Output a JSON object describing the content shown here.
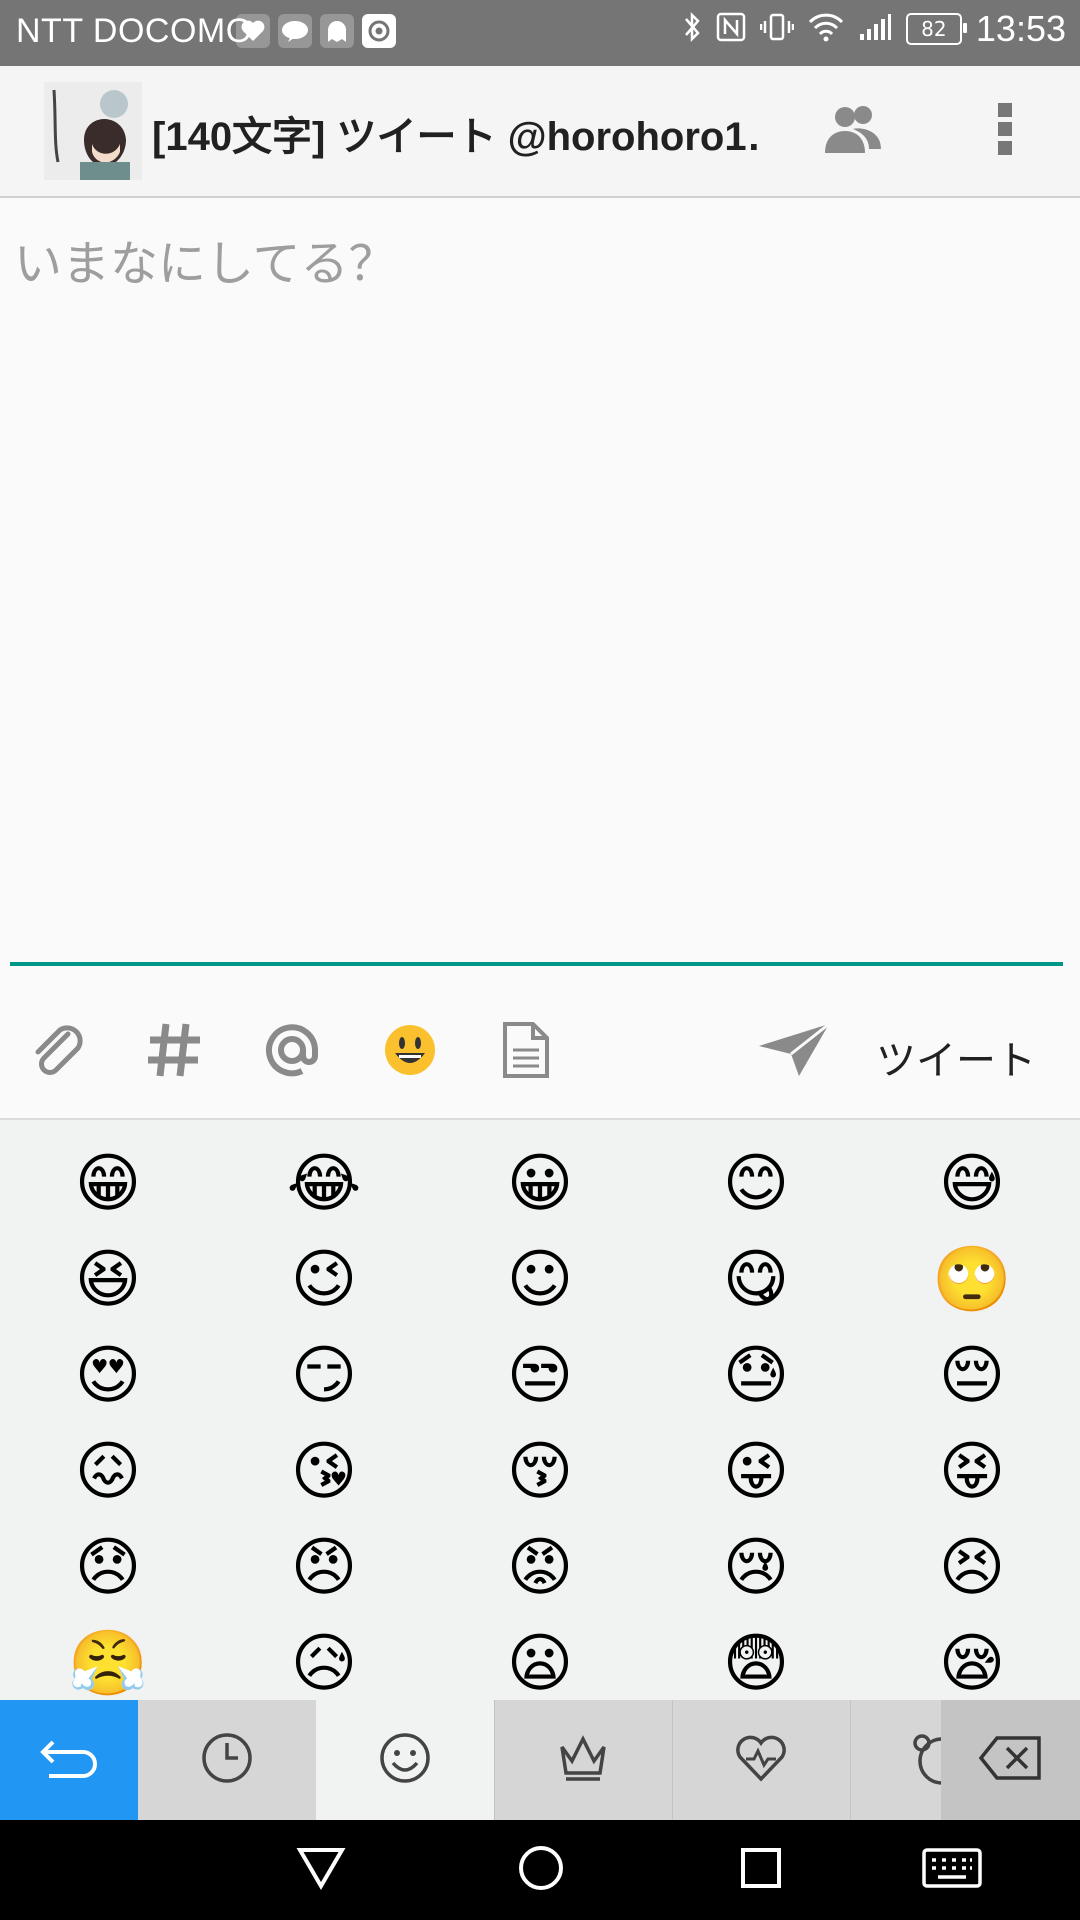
{
  "status_bar": {
    "carrier": "NTT DOCOMO",
    "battery": "82",
    "time": "13:53",
    "notification_icons": [
      "heart-pulse-icon",
      "line-icon",
      "ghost-icon",
      "at-icon"
    ]
  },
  "toolbar": {
    "title": "[140文字] ツイート @horohoro1…",
    "actions": [
      "accounts-icon",
      "overflow-menu-icon"
    ]
  },
  "editor": {
    "placeholder": "いまなにしてる？",
    "value": ""
  },
  "action_bar": {
    "icons": [
      "attach-icon",
      "hashtag-icon",
      "mention-icon",
      "emoji-icon",
      "template-icon",
      "send-icon"
    ],
    "tweet_label": "ツイート"
  },
  "emoji_grid": [
    "😁",
    "😂",
    "😀",
    "😊",
    "😅",
    "😆",
    "😉",
    "☺",
    "😋",
    "🙄",
    "😍",
    "😏",
    "😒",
    "😓",
    "😔",
    "😖",
    "😘",
    "😚",
    "😜",
    "😝",
    "😞",
    "😠",
    "😡",
    "😢",
    "😣",
    "😤",
    "😥",
    "😦",
    "😨",
    "😪"
  ],
  "keyboard_bar": {
    "keys": [
      "back-icon",
      "recent-icon",
      "smiley-icon",
      "crown-icon",
      "heart-icon",
      "animal-icon",
      "backspace-icon"
    ],
    "accent": "#2196f3"
  },
  "colors": {
    "accent_teal": "#009688",
    "status_bar": "#757575"
  }
}
